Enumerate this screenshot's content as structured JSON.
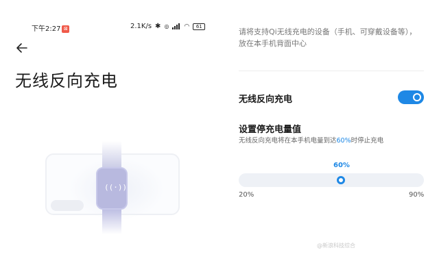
{
  "status_bar": {
    "time": "下午2:27",
    "notification_badge": "⊠",
    "net_speed": "2.1K/s",
    "bluetooth_icon": "bluetooth-icon",
    "battery": "61"
  },
  "header": {
    "back_icon": "back-arrow-icon",
    "title": "无线反向充电"
  },
  "settings": {
    "description": "请将支持Qi无线充电的设备（手机、可穿戴设备等），放在本手机背面中心",
    "reverse_charging": {
      "label": "无线反向充电",
      "enabled": true
    },
    "stop_level": {
      "label": "设置停充电量值",
      "desc_prefix": "无线反向充电将在本手机电量到达",
      "desc_value": "60%",
      "desc_suffix": "时停止充电",
      "value_label": "60%",
      "value": 60,
      "min": 20,
      "max": 90,
      "min_label": "20%",
      "max_label": "90%"
    }
  },
  "watermark": "@新浪科技综合",
  "colors": {
    "accent": "#1e88e5",
    "track": "#eef1f6",
    "watch": "#b8b9df"
  }
}
